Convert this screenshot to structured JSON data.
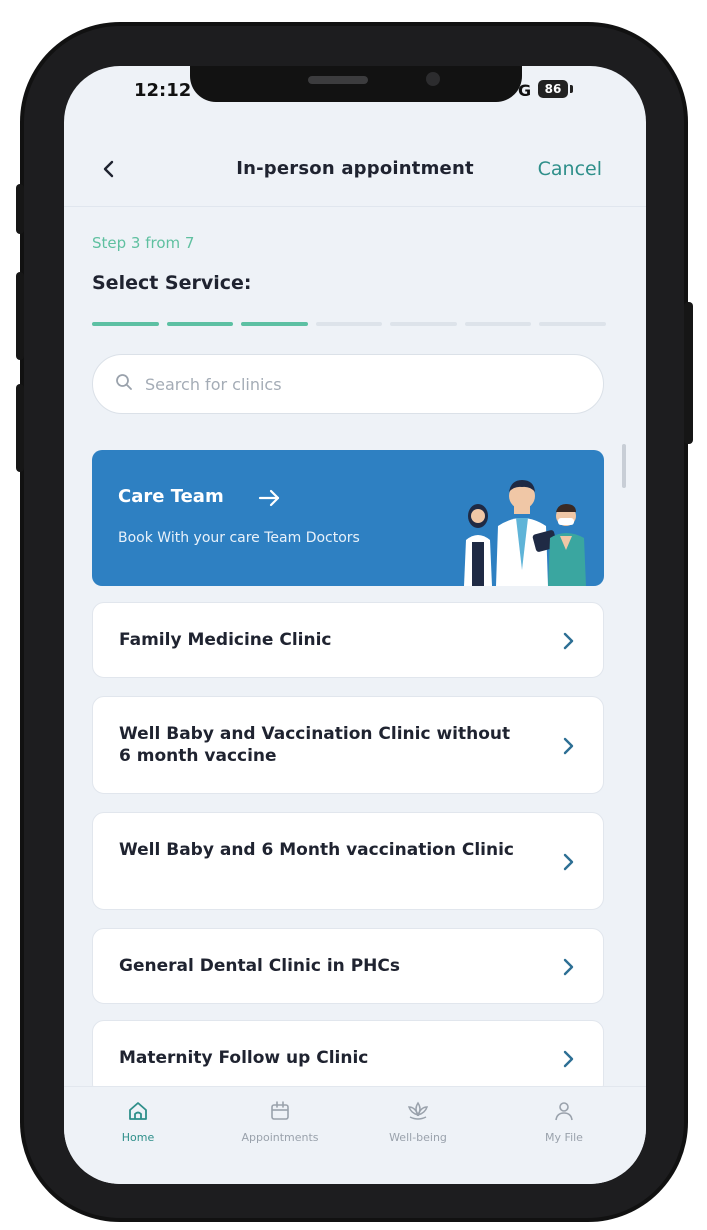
{
  "status_bar": {
    "time": "12:12",
    "network": "G",
    "battery": "86"
  },
  "header": {
    "title": "In-person appointment",
    "cancel_label": "Cancel"
  },
  "step": {
    "label": "Step 3 from 7",
    "title": "Select Service:",
    "current": 3,
    "total": 7
  },
  "search": {
    "placeholder": "Search for clinics",
    "value": ""
  },
  "care_team": {
    "title": "Care Team",
    "subtitle": "Book With your care Team Doctors"
  },
  "clinics": [
    {
      "label": "Family Medicine Clinic"
    },
    {
      "label": "Well Baby and Vaccination Clinic without 6 month vaccine"
    },
    {
      "label": "Well Baby and 6 Month vaccination Clinic"
    },
    {
      "label": "General Dental Clinic in PHCs"
    },
    {
      "label": "Maternity Follow up Clinic"
    }
  ],
  "bottom_nav": {
    "items": [
      {
        "label": "Home",
        "icon": "home-icon",
        "active": true
      },
      {
        "label": "Appointments",
        "icon": "calendar-icon",
        "active": false
      },
      {
        "label": "Well-being",
        "icon": "lotus-icon",
        "active": false
      },
      {
        "label": "My File",
        "icon": "user-icon",
        "active": false
      }
    ]
  },
  "colors": {
    "accent": "#2e8f8a",
    "progress": "#5cc0a3",
    "care_card": "#2e80c2",
    "text": "#1f2330"
  }
}
